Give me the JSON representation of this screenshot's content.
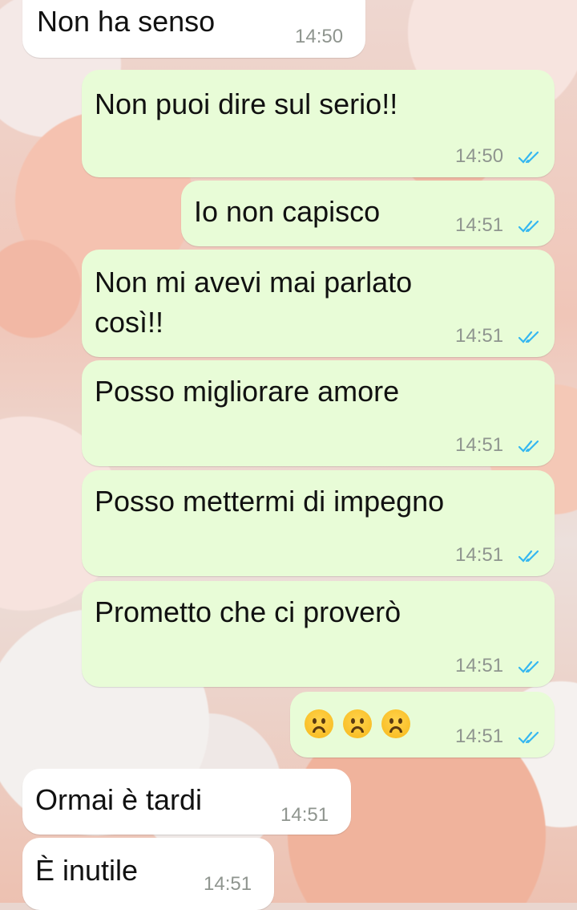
{
  "chat": {
    "messages": [
      {
        "direction": "in",
        "text": "Non ha senso",
        "time": "14:50"
      },
      {
        "direction": "out",
        "text": "Non puoi dire sul serio!!",
        "time": "14:50",
        "status": "read"
      },
      {
        "direction": "out",
        "text": "Io non capisco",
        "time": "14:51",
        "status": "read"
      },
      {
        "direction": "out",
        "text_line1": "Non mi avevi mai parlato",
        "text_line2": "così!!",
        "time": "14:51",
        "status": "read"
      },
      {
        "direction": "out",
        "text": "Posso migliorare amore",
        "time": "14:51",
        "status": "read"
      },
      {
        "direction": "out",
        "text": "Posso mettermi di impegno",
        "time": "14:51",
        "status": "read"
      },
      {
        "direction": "out",
        "text": "Prometto che ci proverò",
        "time": "14:51",
        "status": "read"
      },
      {
        "direction": "out",
        "text": "☹️☹️☹️",
        "emoji": [
          "frowning-face",
          "frowning-face",
          "frowning-face"
        ],
        "time": "14:51",
        "status": "read"
      },
      {
        "direction": "in",
        "text": "Ormai è tardi",
        "time": "14:51"
      },
      {
        "direction": "in",
        "text": "È inutile",
        "time": "14:51"
      }
    ]
  },
  "colors": {
    "incoming_bubble": "#ffffff",
    "outgoing_bubble": "#e8fcd7",
    "read_ticks": "#34b7f1",
    "timestamp": "#8f958f"
  }
}
